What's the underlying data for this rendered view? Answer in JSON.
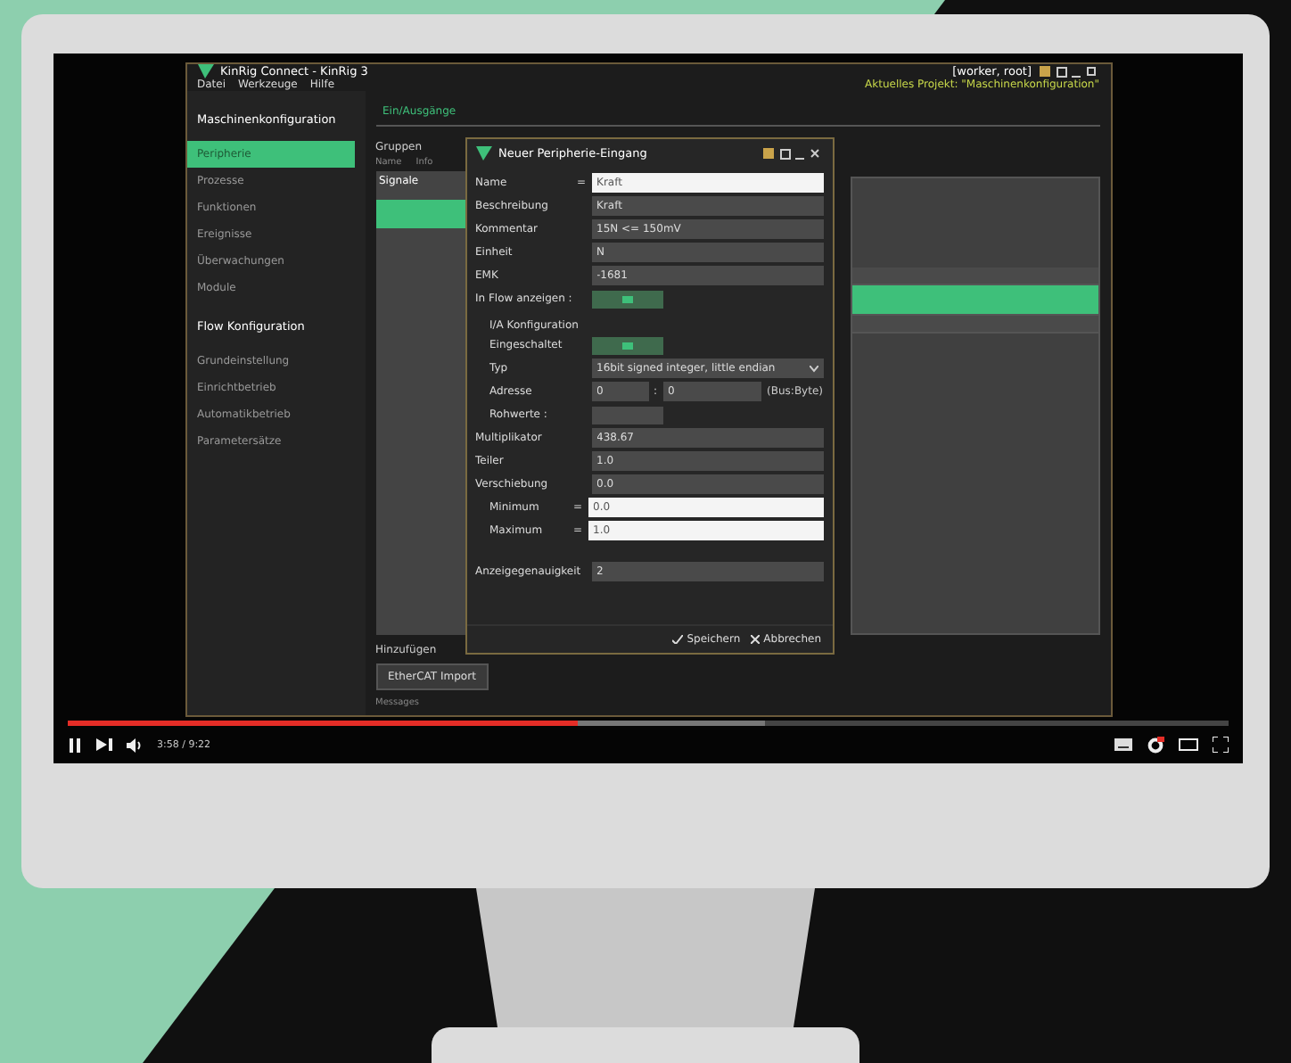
{
  "app": {
    "title": "KinRig Connect - KinRig 3",
    "user": "[worker, root]",
    "project": "Aktuelles Projekt: \"Maschinenkonfiguration\"",
    "menu": [
      "Datei",
      "Werkzeuge",
      "Hilfe"
    ],
    "sidebar": [
      {
        "title": "Maschinenkonfiguration",
        "items": [
          {
            "label": "Peripherie",
            "selected": true
          },
          {
            "label": "Prozesse",
            "selected": false
          },
          {
            "label": "Funktionen",
            "selected": false
          },
          {
            "label": "Ereignisse",
            "selected": false
          },
          {
            "label": "Überwachungen",
            "selected": false
          },
          {
            "label": "Module",
            "selected": false
          }
        ]
      },
      {
        "title": "Flow Konfiguration",
        "items": [
          {
            "label": "Grundeinstellung",
            "selected": false
          },
          {
            "label": "Einrichtbetrieb",
            "selected": false
          },
          {
            "label": "Automatikbetrieb",
            "selected": false
          },
          {
            "label": "Parametersätze",
            "selected": false
          }
        ]
      }
    ],
    "main": {
      "tab": "Ein/Ausgänge",
      "groups_label": "Gruppen",
      "columns": [
        "Name",
        "Info"
      ],
      "groups": [
        {
          "label": "Signale",
          "selected": false
        },
        {
          "selected": true
        }
      ],
      "signal_rows": [
        {
          "selected": false
        },
        {
          "selected": true
        },
        {
          "selected": false
        }
      ],
      "add_label": "Hinzufügen",
      "import_button": "EtherCAT Import",
      "messages_label": "Messages"
    }
  },
  "dialog": {
    "title": "Neuer Peripherie-Eingang",
    "fields": [
      {
        "kind": "formula",
        "label": "Name",
        "prefix": "=",
        "value": "Kraft"
      },
      {
        "kind": "text",
        "label": "Beschreibung",
        "value": "Kraft"
      },
      {
        "kind": "text",
        "label": "Kommentar",
        "value": "15N <= 150mV"
      },
      {
        "kind": "text",
        "label": "Einheit",
        "value": "N"
      },
      {
        "kind": "text",
        "label": "EMK",
        "value": "-1681"
      },
      {
        "kind": "toggle",
        "label": "In Flow anzeigen :",
        "on": true
      },
      {
        "kind": "section",
        "label": "I/A Konfiguration"
      },
      {
        "kind": "toggle",
        "label": "Eingeschaltet",
        "on": true
      },
      {
        "kind": "select",
        "label": "Typ",
        "value": "16bit signed integer, little endian"
      },
      {
        "kind": "address",
        "label": "Adresse",
        "value": "0",
        "separator": ":",
        "value2": "0",
        "unit": "(Bus:Byte)"
      },
      {
        "kind": "button",
        "label": "Rohwerte :"
      },
      {
        "kind": "text",
        "label": "Multiplikator",
        "value": "438.67"
      },
      {
        "kind": "text",
        "label": "Teiler",
        "value": "1.0"
      },
      {
        "kind": "text",
        "label": "Verschiebung",
        "value": "0.0"
      },
      {
        "kind": "formula",
        "label": "Minimum",
        "prefix": "=",
        "value": "0.0"
      },
      {
        "kind": "formula",
        "label": "Maximum",
        "prefix": "=",
        "value": "1.0"
      },
      {
        "kind": "gap"
      },
      {
        "kind": "text",
        "label": "Anzeigegenauigkeit",
        "value": "2"
      }
    ],
    "buttons": [
      {
        "kind": "save",
        "label": "Speichern"
      },
      {
        "kind": "cancel",
        "label": "Abbrechen"
      }
    ]
  },
  "player": {
    "playing": true,
    "progress": {
      "level": 0.44
    },
    "buffer": {
      "level": 0.6
    },
    "time": "3:58 / 9:22"
  }
}
